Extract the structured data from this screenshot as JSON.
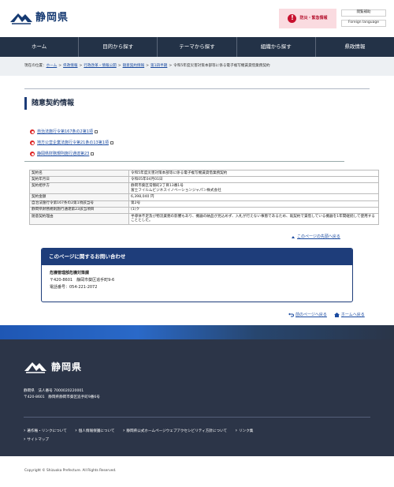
{
  "header": {
    "logo_text": "静岡県",
    "emergency_label": "防災・緊急情報",
    "btn_reading": "閲覧補助",
    "btn_language": "Foreign language"
  },
  "nav": [
    "ホーム",
    "目的から探す",
    "テーマから探す",
    "組織から探す",
    "県政情報"
  ],
  "breadcrumb": {
    "prefix": "現在の位置：",
    "links": [
      "ホーム",
      "県政情報",
      "行政改革・情報公開",
      "随意契約情報",
      "第1四半期"
    ],
    "current": "令和5年度災害対策本部等に係る電子複写機賃貸借業務契約"
  },
  "page_title": "随意契約情報",
  "doc_links": [
    "自治法施行令第167条の2第1項",
    "地方公営企業法施行令第21条の13第1項",
    "静岡県財務規則施行通達第23"
  ],
  "table": [
    {
      "h": "契約名",
      "v": "令和5年度災害対策本部等に係る電子複写機賃貸借業務契約"
    },
    {
      "h": "契約年月日",
      "v": "令和05年04月01日"
    },
    {
      "h": "契約相手方",
      "v": "静岡市葵区常磐町2丁目13番1号\n富士フイルムビジネスイノベーションジャパン株式会社"
    },
    {
      "h": "契約金額",
      "v": "6,398,040 円"
    },
    {
      "h": "自治法施行令第167条の2第1項該当号",
      "v": "第2号"
    },
    {
      "h": "静岡県財務規則施行通達第23該当項目",
      "v": "(1)ク"
    },
    {
      "h": "随意契約理由",
      "v": "半導体不足及び物流業務の影響もあり、機器の納品が見込めず、入札が行えない事態であるため、既契約で賃借している機器を1年間継続して使用することとした。"
    }
  ],
  "page_top": "このページの先頭へ戻る",
  "contact": {
    "heading": "このページに関するお問い合わせ",
    "dept": "危機管理部危機対策課",
    "address": "〒420-8601　静岡市葵区追手町9-6",
    "tel": "電話番号：054-221-2072"
  },
  "back_links": {
    "prev": "前のページへ戻る",
    "home": "ホームへ戻る"
  },
  "footer": {
    "logo_text": "静岡県",
    "addr1": "静岡県　法人番号 7000020220001",
    "addr2": "〒420-8601　静岡県静岡市葵区追手町9番6号",
    "links": [
      "著作権・リンクについて",
      "個人情報保護について",
      "静岡県公式ホームページウェブアクセシビリティ方針について",
      "リンク集",
      "サイトマップ"
    ],
    "copyright": "Copyright © Shizuoka Prefecture. All Rights Reserved."
  },
  "colors": {
    "nav_bg": "#233247",
    "brand": "#163a72",
    "emergency": "#c8102e",
    "footer_bg": "#2c3548"
  },
  "icons": [
    "logo-mountain-icon",
    "alert-icon",
    "pdf-icon",
    "external-window-icon",
    "triangle-up-icon",
    "back-arrow-icon",
    "home-icon"
  ]
}
